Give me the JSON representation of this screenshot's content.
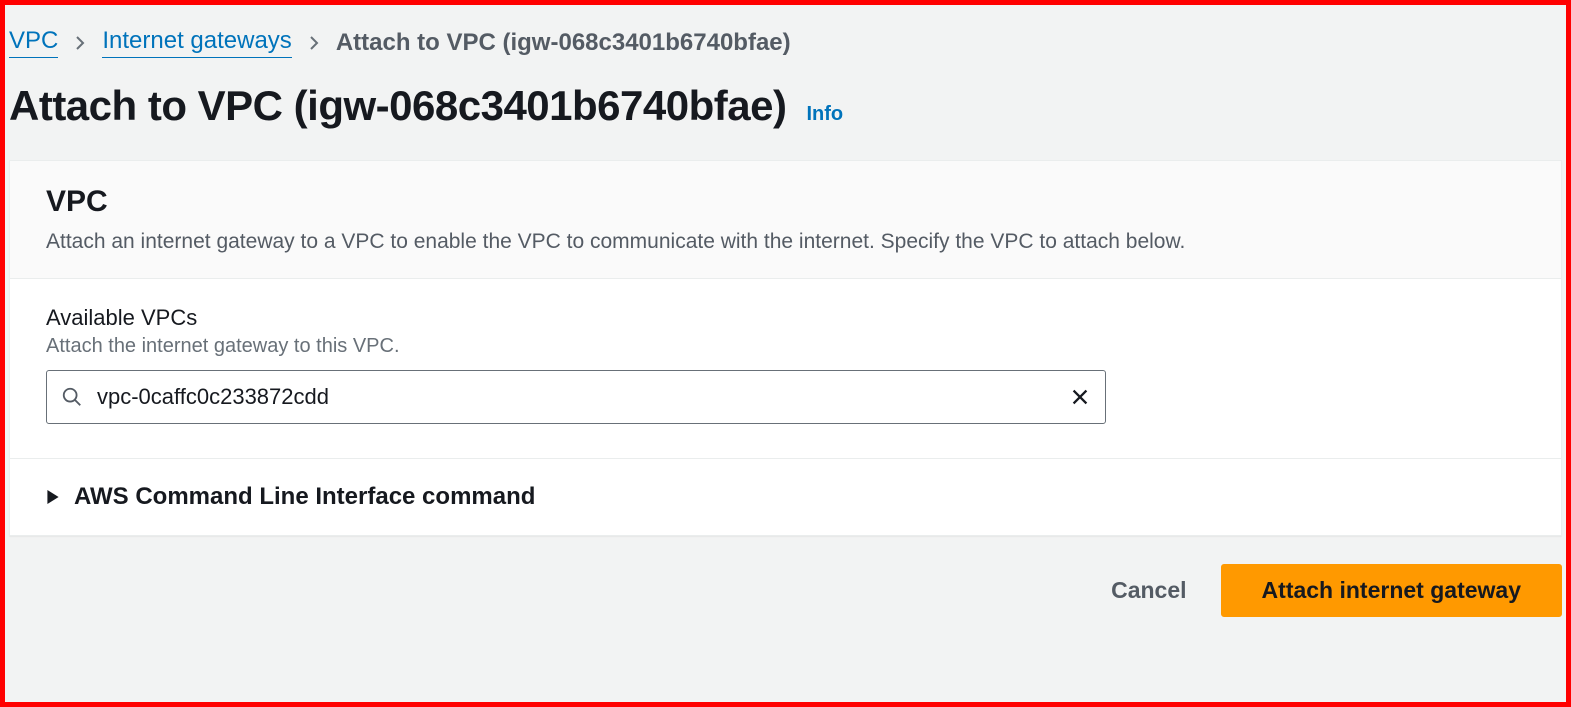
{
  "breadcrumb": {
    "root": "VPC",
    "mid": "Internet gateways",
    "current": "Attach to VPC (igw-068c3401b6740bfae)"
  },
  "header": {
    "title": "Attach to VPC (igw-068c3401b6740bfae)",
    "info": "Info"
  },
  "panel": {
    "title": "VPC",
    "description": "Attach an internet gateway to a VPC to enable the VPC to communicate with the internet. Specify the VPC to attach below.",
    "field_label": "Available VPCs",
    "field_hint": "Attach the internet gateway to this VPC.",
    "search_value": "vpc-0caffc0c233872cdd",
    "cli_toggle": "AWS Command Line Interface command"
  },
  "footer": {
    "cancel": "Cancel",
    "submit": "Attach internet gateway"
  },
  "colors": {
    "accent": "#ff9900",
    "link": "#0073bb"
  }
}
